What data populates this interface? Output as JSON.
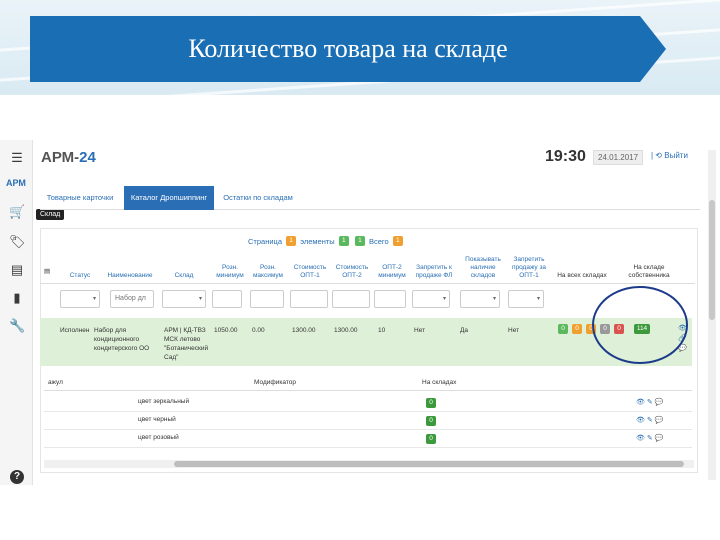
{
  "slide": {
    "title": "Количество товара на складе"
  },
  "app": {
    "logo_prefix": "АРМ-",
    "logo_number": "24",
    "clock": "19:30",
    "date": "24.01.2017",
    "exit": "| ⟲ Выйти",
    "sidebar": {
      "label": "АРМ",
      "tooltip": "Склад",
      "help": "?"
    },
    "tabs": [
      "Товарные карточки",
      "Каталог Дропшиппинг",
      "Остатки по складам"
    ],
    "pager": {
      "page_label": "Страница",
      "page": "1",
      "items_label": "элементы",
      "from": "1",
      "to": "1",
      "total_label": "Всего",
      "total": "1"
    },
    "columns": [
      "Статус",
      "Наименование",
      "Склад",
      "Розн. минимум",
      "Розн. максимум",
      "Стоимость ОПТ-1",
      "Стоимость ОПТ-2",
      "ОПТ-2 минимум",
      "Запретить к продаже ФЛ",
      "Показывать наличие складов",
      "Запретить продажу за ОПТ-1",
      "На всех складах",
      "На складе собственника"
    ],
    "filters": {
      "name_placeholder": "Набор дл",
      "caret": "▾"
    },
    "row": {
      "status": "Исполнен",
      "name": "Набор для кондиционного кондитерского ОО",
      "warehouse": "АРМ | КД-ТВЗ МСК летово \"Ботанический Сад\"",
      "retail_min": "1050.00",
      "retail_max": "0.00",
      "opt1": "1300.00",
      "opt2": "1300.00",
      "opt2_min": "10",
      "ban_fl": "Нет",
      "show_stock": "Да",
      "ban_opt1": "Нет",
      "all_warehouses": [
        "0",
        "0",
        "0",
        "0",
        "0"
      ],
      "owner_warehouse": "114",
      "icons": "👁\n🔗\n💬"
    },
    "subtable": {
      "headers": [
        "ажул",
        "Модификатор",
        "На складах"
      ],
      "rows": [
        {
          "name": "цвет зеркальный",
          "stock": "0",
          "icons": "👁 ✎ 💬"
        },
        {
          "name": "цвет черный",
          "stock": "0",
          "icons": "👁 ✎ 💬"
        },
        {
          "name": "цвет розовый",
          "stock": "0",
          "icons": "👁 ✎ 💬"
        }
      ]
    }
  },
  "colors": {
    "brand": "#1a6eb4",
    "accent": "#2a6fb5",
    "row_highlight": "#dff0d8"
  },
  "icons": [
    "menu-icon",
    "cart-icon",
    "tag-icon",
    "list-icon",
    "document-icon",
    "wrench-icon",
    "help-icon",
    "eye-icon",
    "link-icon",
    "comment-icon"
  ]
}
